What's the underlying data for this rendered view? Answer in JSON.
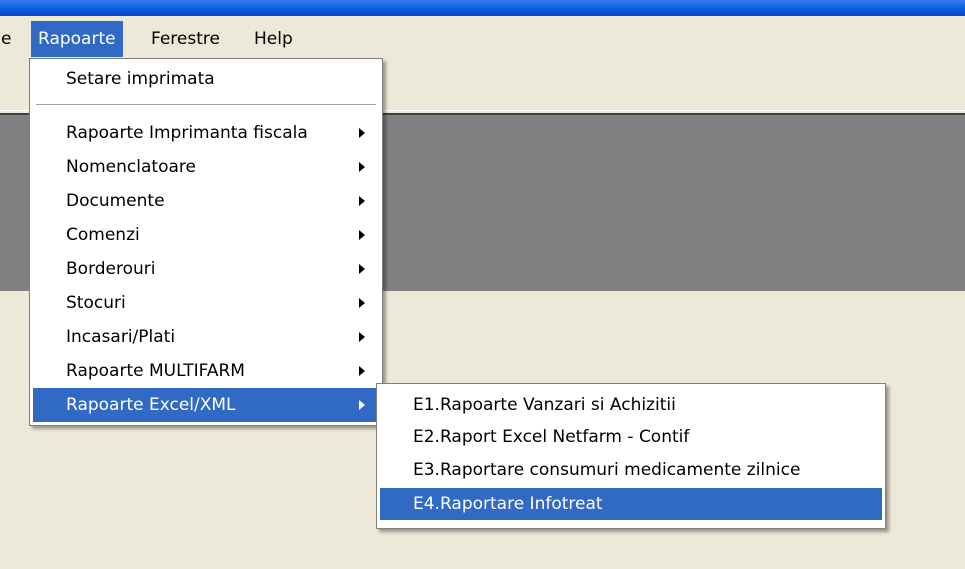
{
  "menubar": {
    "partial_label": "e",
    "items": [
      {
        "label": "Rapoarte"
      },
      {
        "label": "Ferestre"
      },
      {
        "label": "Help"
      }
    ]
  },
  "rapoarte_menu": {
    "items": [
      {
        "label": "Setare imprimata"
      },
      {
        "label": "Rapoarte Imprimanta fiscala"
      },
      {
        "label": "Nomenclatoare"
      },
      {
        "label": "Documente"
      },
      {
        "label": "Comenzi"
      },
      {
        "label": "Borderouri"
      },
      {
        "label": "Stocuri"
      },
      {
        "label": "Incasari/Plati"
      },
      {
        "label": "Rapoarte MULTIFARM"
      },
      {
        "label": "Rapoarte Excel/XML"
      }
    ]
  },
  "excel_submenu": {
    "items": [
      {
        "label": "E1.Rapoarte Vanzari si Achizitii"
      },
      {
        "label": "E2.Raport Excel Netfarm - Contif"
      },
      {
        "label": "E3.Raportare consumuri medicamente zilnice"
      },
      {
        "label": "E4.Raportare Infotreat"
      }
    ]
  }
}
